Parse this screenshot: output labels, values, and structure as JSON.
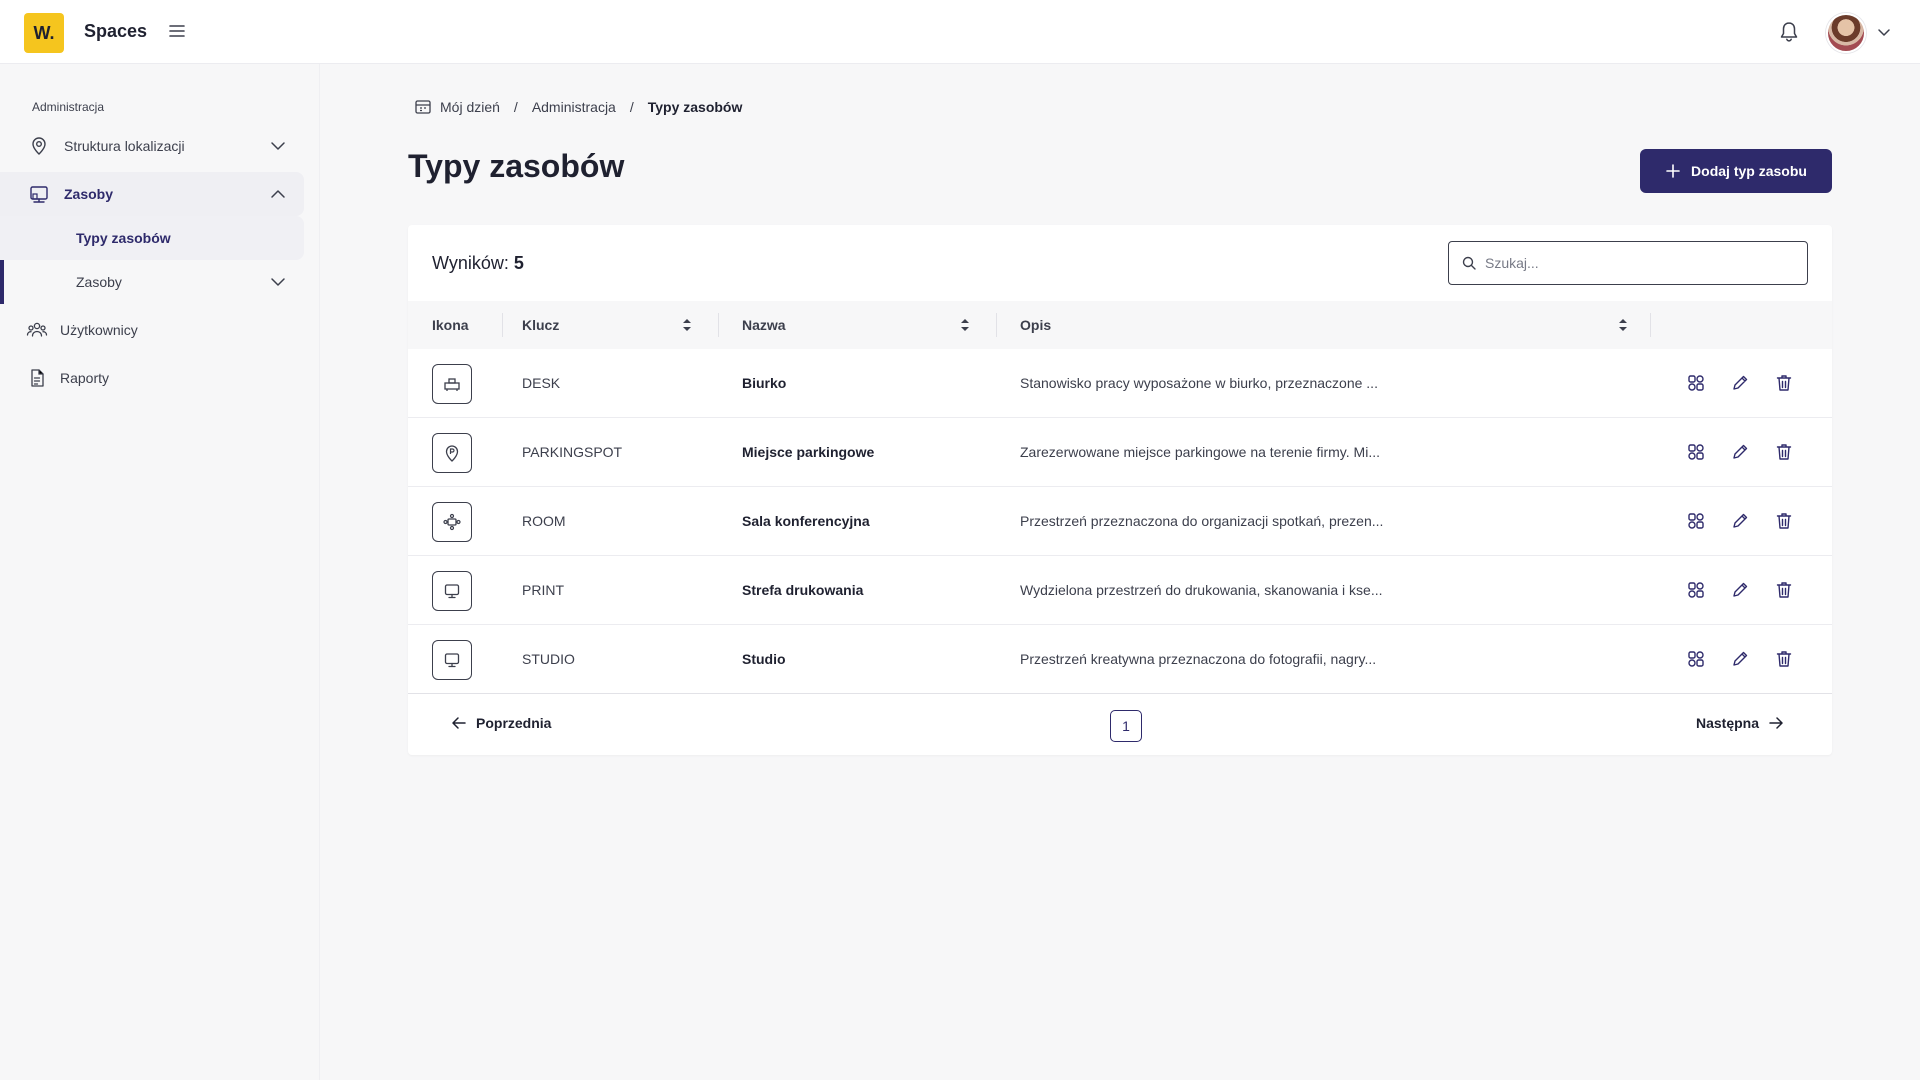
{
  "app": {
    "logo_text": "W.",
    "name": "Spaces",
    "brand_color": "#f5c51e",
    "accent_color": "#2e2a6b"
  },
  "header": {
    "menu_icon": "hamburger-icon",
    "notification_icon": "bell-icon",
    "avatar_icon": "user-avatar",
    "avatar_menu_icon": "chevron-down-icon"
  },
  "sidebar": {
    "section_title": "Administracja",
    "items": [
      {
        "label": "Struktura lokalizacji",
        "icon": "location-pin-icon",
        "expanded": false
      },
      {
        "label": "Zasoby",
        "icon": "desk-resource-icon",
        "expanded": true,
        "children": [
          {
            "label": "Typy zasobów",
            "active": true
          },
          {
            "label": "Zasoby",
            "active": false,
            "expandable": true
          }
        ]
      },
      {
        "label": "Użytkownicy",
        "icon": "users-icon"
      },
      {
        "label": "Raporty",
        "icon": "report-icon"
      }
    ]
  },
  "breadcrumb": {
    "items": [
      "Mój dzień",
      "Administracja",
      "Typy zasobów"
    ],
    "separator": "/"
  },
  "page": {
    "title": "Typy zasobów",
    "add_button_label": "Dodaj typ zasobu"
  },
  "table": {
    "results_label": "Wyników:",
    "results_count": "5",
    "search_placeholder": "Szukaj...",
    "columns": [
      "Ikona",
      "Klucz",
      "Nazwa",
      "Opis"
    ],
    "rows": [
      {
        "icon": "desk-icon",
        "key": "DESK",
        "name": "Biurko",
        "description": "Stanowisko pracy wyposażone w biurko, przeznaczone ..."
      },
      {
        "icon": "parking-pin-icon",
        "key": "PARKINGSPOT",
        "name": "Miejsce parkingowe",
        "description": "Zarezerwowane miejsce parkingowe na terenie firmy. Mi..."
      },
      {
        "icon": "conference-room-icon",
        "key": "ROOM",
        "name": "Sala konferencyjna",
        "description": "Przestrzeń przeznaczona do organizacji spotkań, prezen..."
      },
      {
        "icon": "monitor-icon",
        "key": "PRINT",
        "name": "Strefa drukowania",
        "description": "Wydzielona przestrzeń do drukowania, skanowania i kse..."
      },
      {
        "icon": "monitor-icon",
        "key": "STUDIO",
        "name": "Studio",
        "description": "Przestrzeń kreatywna przeznaczona do fotografii, nagry..."
      }
    ],
    "row_actions": [
      "attributes-icon",
      "edit-icon",
      "delete-icon"
    ]
  },
  "pagination": {
    "prev_label": "Poprzednia",
    "next_label": "Następna",
    "current_page": "1"
  }
}
